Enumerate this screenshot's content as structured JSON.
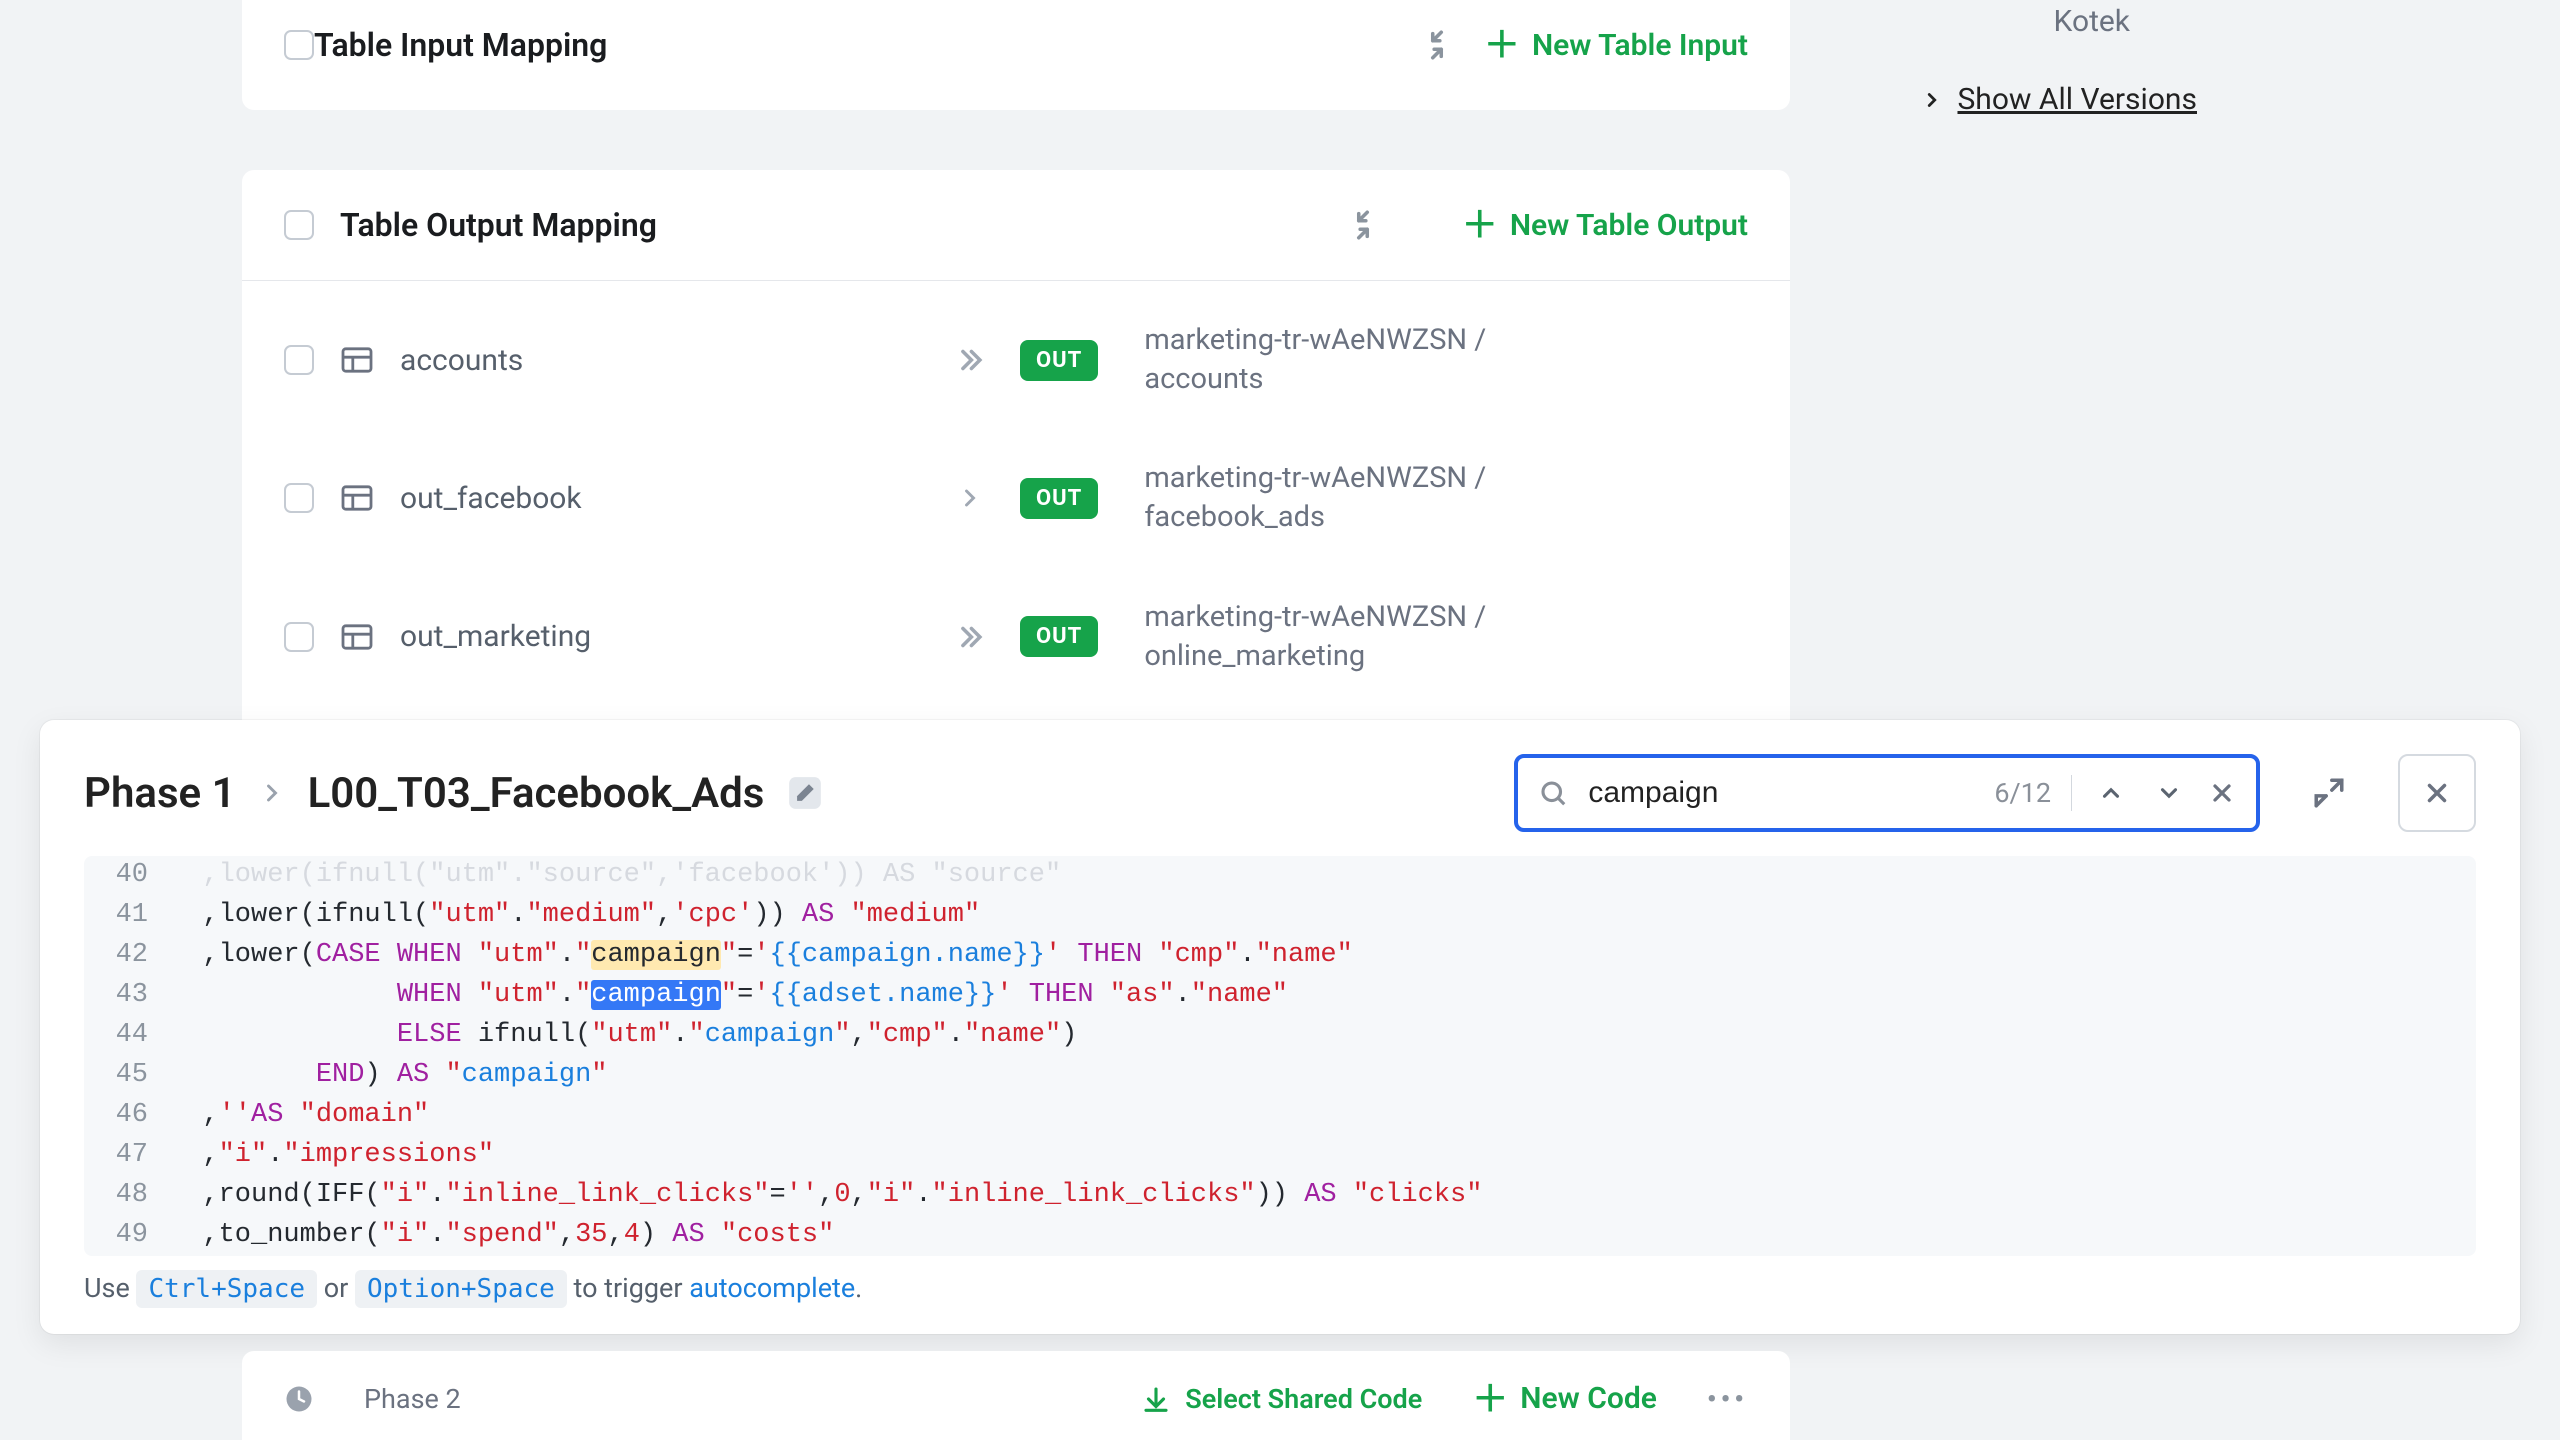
{
  "sidebar": {
    "user": "Kotek",
    "show_all": "Show All Versions"
  },
  "input_card": {
    "title": "Table Input Mapping",
    "new_btn": "New Table Input"
  },
  "output_card": {
    "title": "Table Output Mapping",
    "new_btn": "New Table Output",
    "badge": "OUT",
    "rows": [
      {
        "name": "accounts",
        "dest1": "marketing-tr-wAeNWZSN /",
        "dest2": "accounts",
        "chev": "dbl"
      },
      {
        "name": "out_facebook",
        "dest1": "marketing-tr-wAeNWZSN /",
        "dest2": "facebook_ads",
        "chev": "single"
      },
      {
        "name": "out_marketing",
        "dest1": "marketing-tr-wAeNWZSN /",
        "dest2": "online_marketing",
        "chev": "dbl"
      }
    ]
  },
  "editor": {
    "crumb1": "Phase 1",
    "crumb2": "L00_T03_Facebook_Ads",
    "search": {
      "value": "campaign",
      "count": "6/12"
    },
    "hint_pre": "Use ",
    "kbd1": "Ctrl+Space",
    "hint_or": " or ",
    "kbd2": "Option+Space",
    "hint_mid": " to trigger ",
    "hint_link": "autocomplete",
    "hint_end": "."
  },
  "code": {
    "lines": [
      40,
      41,
      42,
      43,
      44,
      45,
      46,
      47,
      48,
      49
    ]
  },
  "footer": {
    "phase2": "Phase 2",
    "select_shared": "Select Shared Code",
    "new_code": "New Code"
  }
}
